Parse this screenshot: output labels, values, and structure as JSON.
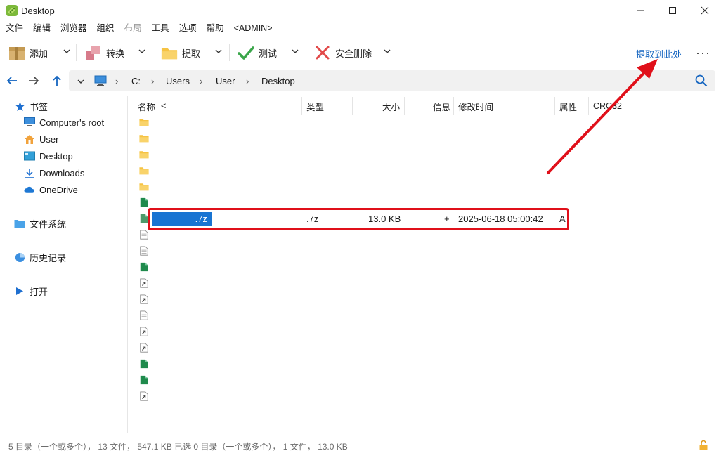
{
  "window": {
    "title": "Desktop",
    "controls": [
      "minimize-icon",
      "maximize-icon",
      "close-icon"
    ]
  },
  "menu": [
    {
      "label": "文件",
      "enabled": true
    },
    {
      "label": "编辑",
      "enabled": true
    },
    {
      "label": "浏览器",
      "enabled": true
    },
    {
      "label": "组织",
      "enabled": true
    },
    {
      "label": "布局",
      "enabled": false
    },
    {
      "label": "工具",
      "enabled": true
    },
    {
      "label": "选项",
      "enabled": true
    },
    {
      "label": "帮助",
      "enabled": true
    },
    {
      "label": "<ADMIN>",
      "enabled": true
    }
  ],
  "toolbar": {
    "add_label": "添加",
    "convert_label": "转换",
    "extract_label": "提取",
    "test_label": "测试",
    "delete_label": "安全删除",
    "extract_here_label": "提取到此处",
    "more_label": "···"
  },
  "breadcrumb": [
    "C:",
    "Users",
    "User",
    "Desktop"
  ],
  "sidebar": {
    "bookmarks_label": "书签",
    "bookmarks": [
      {
        "label": "Computer's root",
        "icon": "monitor-icon"
      },
      {
        "label": "User",
        "icon": "home-icon"
      },
      {
        "label": "Desktop",
        "icon": "desktop-icon"
      },
      {
        "label": "Downloads",
        "icon": "download-icon"
      },
      {
        "label": "OneDrive",
        "icon": "cloud-icon"
      }
    ],
    "filesystem_label": "文件系统",
    "history_label": "历史记录",
    "open_label": "打开"
  },
  "columns": {
    "name": "名称",
    "sort_indicator": "<",
    "type": "类型",
    "size": "大小",
    "info": "信息",
    "modified": "修改时间",
    "attr": "属性",
    "crc": "CRC32"
  },
  "rows": [
    {
      "icon": "folder-icon"
    },
    {
      "icon": "folder-icon"
    },
    {
      "icon": "folder-icon"
    },
    {
      "icon": "folder-icon"
    },
    {
      "icon": "folder-icon"
    },
    {
      "icon": "spreadsheet-icon"
    },
    {
      "icon": "archive-icon",
      "selected": true,
      "name": ".7z",
      "type": ".7z",
      "size": "13.0 KB",
      "info": "+",
      "modified": "2025-06-18 05:00:42",
      "attr": "A"
    },
    {
      "icon": "document-icon"
    },
    {
      "icon": "document-icon"
    },
    {
      "icon": "spreadsheet-icon"
    },
    {
      "icon": "shortcut-icon"
    },
    {
      "icon": "shortcut-icon"
    },
    {
      "icon": "document-icon"
    },
    {
      "icon": "shortcut-icon"
    },
    {
      "icon": "shortcut-icon"
    },
    {
      "icon": "spreadsheet-icon"
    },
    {
      "icon": "spreadsheet-icon"
    },
    {
      "icon": "shortcut-icon"
    }
  ],
  "selected": {
    "name": ".7z",
    "type": ".7z",
    "size": "13.0 KB",
    "info": "+",
    "modified": "2025-06-18 05:00:42",
    "attr": "A"
  },
  "status": {
    "text": "5 目录（一个或多个）， 13 文件， 547.1 KB   已选 0 目录（一个或多个）， 1 文件， 13.0 KB"
  },
  "colors": {
    "accent": "#1874d2",
    "link": "#1565c0",
    "annotation": "#e0101a",
    "folder": "#f6c343"
  }
}
